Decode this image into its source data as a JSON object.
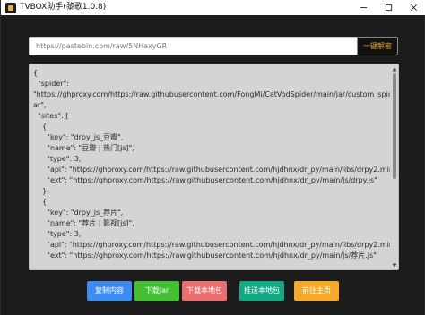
{
  "window": {
    "title": "TVBOX助手(黎歌1.0.8)",
    "controls": {
      "minimize": "minimize-icon",
      "maximize": "maximize-icon",
      "close": "close-icon"
    }
  },
  "url_bar": {
    "value": "https://pastebin.com/raw/5NHaxyGR",
    "parse_label": "一键解密"
  },
  "editor": {
    "lines": [
      "{",
      "  \"spider\":",
      "\"https://ghproxy.com/https://raw.githubusercontent.com/FongMi/CatVodSpider/main/jar/custom_spider.j",
      "ar\",",
      "  \"sites\": [",
      "    {",
      "      \"key\": \"drpy_js_豆瓣\",",
      "      \"name\": \"豆瓣 | 热门[js]\",",
      "      \"type\": 3,",
      "      \"api\": \"https://ghproxy.com/https://raw.githubusercontent.com/hjdhnx/dr_py/main/libs/drpy2.min.js\",",
      "      \"ext\": \"https://ghproxy.com/https://raw.githubusercontent.com/hjdhnx/dr_py/main/js/drpy.js\"",
      "    },",
      "    {",
      "      \"key\": \"drpy_js_荐片\",",
      "      \"name\": \"荐片 | 影视[js]\",",
      "      \"type\": 3,",
      "      \"api\": \"https://ghproxy.com/https://raw.githubusercontent.com/hjdhnx/dr_py/main/libs/drpy2.min.js\",",
      "      \"ext\": \"https://ghproxy.com/https://raw.githubusercontent.com/hjdhnx/dr_py/main/js/荐片.js\""
    ]
  },
  "buttons": [
    {
      "label": "复制内容",
      "color": "#3f8cf0"
    },
    {
      "label": "下载Jar",
      "color": "#43bf33"
    },
    {
      "label": "下载本地包",
      "color": "#ec6f6f"
    },
    {
      "label": "推送本地包",
      "color": "#11a883"
    },
    {
      "label": "前往主页",
      "color": "#f7a92c"
    }
  ]
}
